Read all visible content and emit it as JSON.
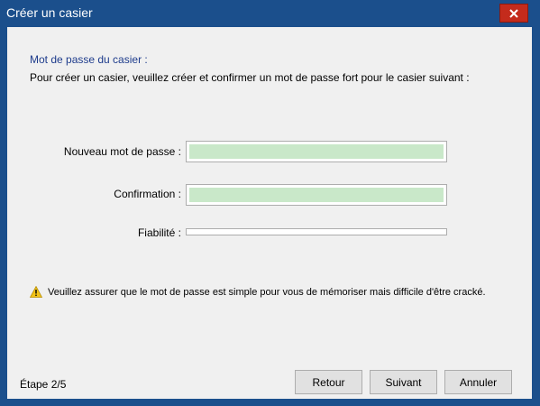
{
  "window": {
    "title": "Créer un casier",
    "close_icon": "close-icon"
  },
  "content": {
    "section_title": "Mot de passe du casier :",
    "instruction": "Pour créer un casier, veuillez créer et confirmer un mot de passe fort pour le casier suivant :"
  },
  "form": {
    "new_password_label": "Nouveau mot de passe :",
    "confirm_label": "Confirmation :",
    "strength_label": "Fiabilité :",
    "strength_level": 0
  },
  "warning": {
    "icon": "warning-icon",
    "text": "Veuillez assurer que le mot de passe est simple pour vous de mémoriser mais difficile d'être cracké."
  },
  "footer": {
    "step": "Étape 2/5",
    "back": "Retour",
    "next": "Suivant",
    "cancel": "Annuler"
  },
  "colors": {
    "titlebar": "#1b4f8c",
    "close_button": "#c42b1c",
    "section_title": "#1e3c8c",
    "input_fill": "#c9e8c9"
  }
}
